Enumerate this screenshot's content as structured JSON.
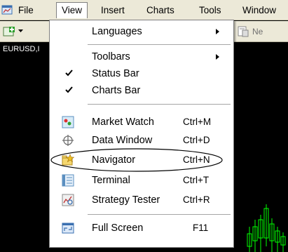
{
  "menubar": {
    "items": [
      "File",
      "View",
      "Insert",
      "Charts",
      "Tools",
      "Window"
    ],
    "active": "View"
  },
  "toolbar": {
    "partial_label": "Ne"
  },
  "chart": {
    "symbol": "EURUSD,I"
  },
  "view_menu": {
    "items": [
      {
        "label": "Languages",
        "submenu": true
      },
      {
        "label": "Toolbars",
        "submenu": true
      },
      {
        "label": "Status Bar",
        "checked": true
      },
      {
        "label": "Charts Bar",
        "checked": true
      },
      {
        "label": "Market Watch",
        "shortcut": "Ctrl+M",
        "icon": "market-watch-icon"
      },
      {
        "label": "Data Window",
        "shortcut": "Ctrl+D",
        "icon": "data-window-icon"
      },
      {
        "label": "Navigator",
        "shortcut": "Ctrl+N",
        "icon": "navigator-icon",
        "circled": true
      },
      {
        "label": "Terminal",
        "shortcut": "Ctrl+T",
        "icon": "terminal-icon"
      },
      {
        "label": "Strategy Tester",
        "shortcut": "Ctrl+R",
        "icon": "strategy-tester-icon"
      },
      {
        "label": "Full Screen",
        "shortcut": "F11",
        "icon": "full-screen-icon"
      }
    ]
  },
  "colors": {
    "menubar_bg": "#ece9d8",
    "chart_bg": "#000000",
    "candle_color": "#00ff00",
    "annotation_ellipse": "#000000"
  }
}
